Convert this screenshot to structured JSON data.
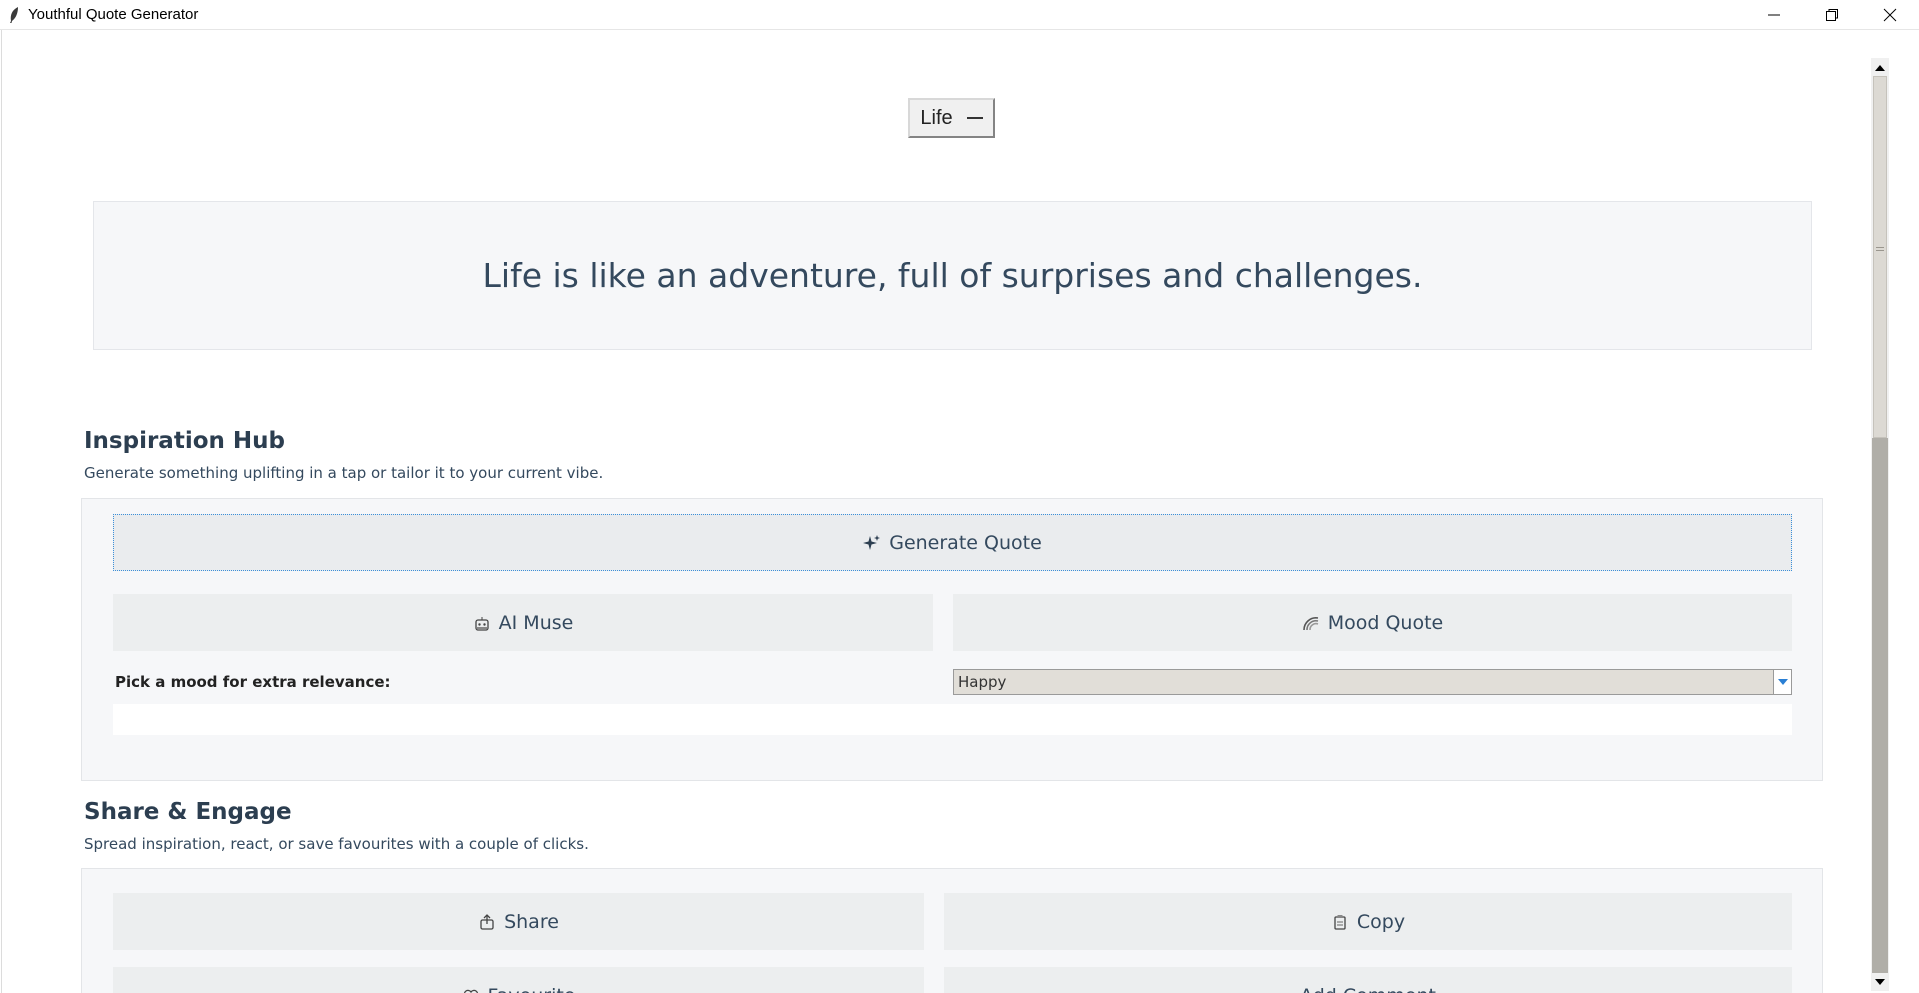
{
  "window": {
    "title": "Youthful Quote Generator"
  },
  "category": {
    "value": "Life"
  },
  "quote": {
    "text": "Life is like an adventure, full of surprises and challenges."
  },
  "inspiration": {
    "title": "Inspiration Hub",
    "subtitle": "Generate something uplifting in a tap or tailor it to your current vibe.",
    "generate_label": "Generate Quote",
    "ai_muse_label": "AI Muse",
    "mood_quote_label": "Mood Quote",
    "mood_label": "Pick a mood for extra relevance:",
    "mood_value": "Happy"
  },
  "share": {
    "title": "Share & Engage",
    "subtitle": "Spread inspiration, react, or save favourites with a couple of clicks.",
    "share_label": "Share",
    "copy_label": "Copy",
    "favourite_label": "Favourite",
    "comment_label": "Add Comment"
  },
  "colors": {
    "heading": "#2c3e50",
    "panel": "#f6f7f9",
    "button": "#eceeef",
    "focus": "#3b8fd9"
  }
}
